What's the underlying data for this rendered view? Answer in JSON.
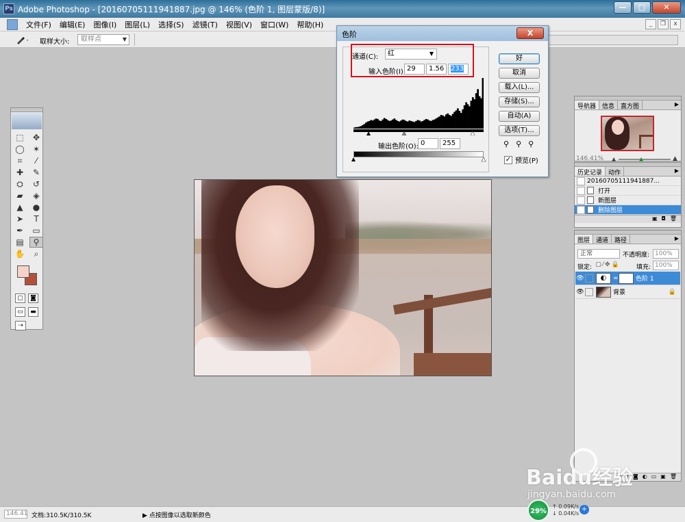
{
  "window": {
    "title": "Adobe Photoshop - [20160705111941887.jpg @ 146% (色阶 1, 图层蒙版/8)]",
    "app_icon_text": "Ps",
    "minimize": "—",
    "maximize": "□",
    "close": "✕"
  },
  "menu": {
    "items": [
      "文件(F)",
      "编辑(E)",
      "图像(I)",
      "图层(L)",
      "选择(S)",
      "滤镜(T)",
      "视图(V)",
      "窗口(W)",
      "帮助(H)"
    ],
    "doc_minimize": "_",
    "doc_restore": "❐",
    "doc_close": "x"
  },
  "options_bar": {
    "tool_icon": "eyedropper-icon",
    "sample_size_label": "取样大小:",
    "sample_size_value": "取样点"
  },
  "levels_dialog": {
    "title": "色阶",
    "close": "X",
    "channel_label": "通道(C):",
    "channel_value": "红",
    "input_label": "输入色阶(I):",
    "input_black": "29",
    "input_gamma": "1.56",
    "input_white": "233",
    "output_label": "输出色阶(O):",
    "output_black": "0",
    "output_white": "255",
    "buttons": {
      "ok": "好",
      "cancel": "取消",
      "load": "载入(L)...",
      "save": "存储(S)...",
      "auto": "自动(A)",
      "options": "选项(T)..."
    },
    "preview_label": "预览(P)",
    "preview_checked": true,
    "highlight_color": "#d6101a",
    "histogram": [
      2,
      3,
      3,
      4,
      5,
      7,
      9,
      12,
      14,
      15,
      17,
      16,
      18,
      20,
      19,
      16,
      15,
      18,
      21,
      19,
      17,
      15,
      16,
      18,
      20,
      17,
      15,
      14,
      16,
      18,
      17,
      15,
      14,
      16,
      15,
      14,
      13,
      15,
      17,
      16,
      14,
      15,
      17,
      19,
      18,
      16,
      15,
      17,
      18,
      20,
      22,
      24,
      27,
      26,
      24,
      28,
      30,
      27,
      25,
      29,
      33,
      36,
      40,
      35,
      31,
      38,
      46,
      52,
      48,
      44,
      55,
      62,
      58,
      70,
      78,
      64,
      60,
      100
    ]
  },
  "navigator": {
    "tabs": [
      "导航器",
      "信息",
      "直方图"
    ],
    "zoom": "146.41%"
  },
  "history": {
    "tabs": [
      "历史记录",
      "动作"
    ],
    "snapshot": "20160705111941887...",
    "items": [
      "打开",
      "新图层",
      "删除图层"
    ],
    "selected_index": 2
  },
  "layers": {
    "tabs": [
      "图层",
      "通道",
      "路径"
    ],
    "blend_mode": "正常",
    "opacity_label": "不透明度:",
    "opacity": "100%",
    "lock_label": "锁定:",
    "fill_label": "填充:",
    "fill": "100%",
    "list": [
      {
        "name": "色阶 1",
        "selected": true
      },
      {
        "name": "背景",
        "selected": false
      }
    ]
  },
  "status": {
    "zoom": "146.41",
    "doc_size": "文档:310.5K/310.5K",
    "hint": "点按图像以选取新颜色"
  },
  "network": {
    "percent": "29%",
    "up": "0.09K/s",
    "down": "0.04K/s",
    "plus": "+"
  },
  "watermark": {
    "logo": "Baidu经验",
    "url": "jingyan.baidu.com"
  }
}
